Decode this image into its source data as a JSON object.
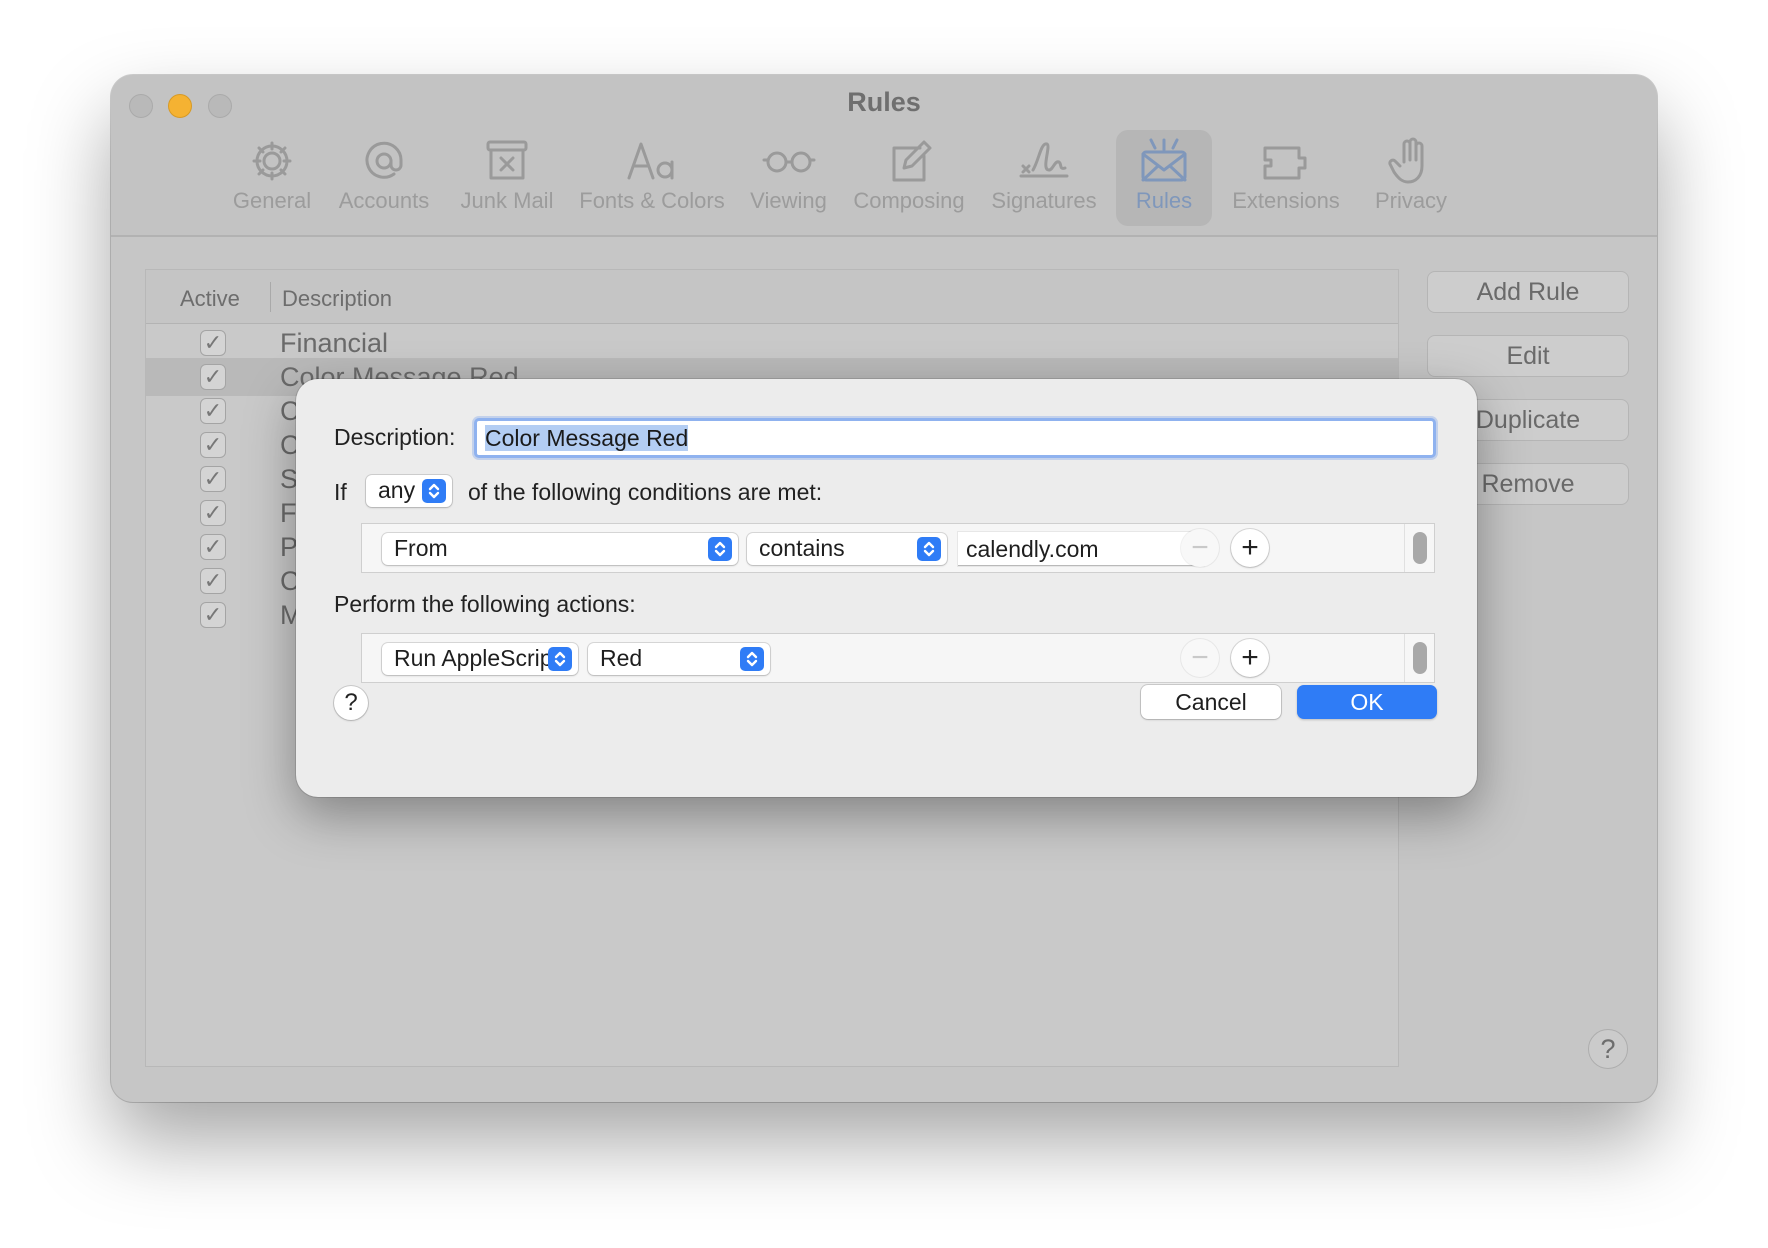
{
  "window": {
    "title": "Rules"
  },
  "toolbar": {
    "items": [
      {
        "label": "General",
        "icon": "gear-icon"
      },
      {
        "label": "Accounts",
        "icon": "at-sign-icon"
      },
      {
        "label": "Junk Mail",
        "icon": "junk-mail-icon"
      },
      {
        "label": "Fonts & Colors",
        "icon": "fonts-icon"
      },
      {
        "label": "Viewing",
        "icon": "glasses-icon"
      },
      {
        "label": "Composing",
        "icon": "compose-icon"
      },
      {
        "label": "Signatures",
        "icon": "signature-icon"
      },
      {
        "label": "Rules",
        "icon": "rules-envelope-icon",
        "selected": true
      },
      {
        "label": "Extensions",
        "icon": "extensions-icon"
      },
      {
        "label": "Privacy",
        "icon": "hand-icon"
      }
    ]
  },
  "rules_table": {
    "columns": {
      "active": "Active",
      "description": "Description"
    },
    "rows": [
      {
        "name": "Financial",
        "active": true
      },
      {
        "name": "Color Message Red",
        "active": true,
        "selected": true
      },
      {
        "name": "C",
        "active": true
      },
      {
        "name": "C",
        "active": true
      },
      {
        "name": "S",
        "active": true
      },
      {
        "name": "F",
        "active": true
      },
      {
        "name": "P",
        "active": true
      },
      {
        "name": "C",
        "active": true
      },
      {
        "name": "M",
        "active": true
      }
    ]
  },
  "side_buttons": {
    "add": "Add Rule",
    "edit": "Edit",
    "duplicate": "Duplicate",
    "remove": "Remove"
  },
  "window_help": "?",
  "sheet": {
    "description_label": "Description:",
    "description_value": "Color Message Red",
    "if_label": "If",
    "match_value": "any",
    "conditions_label": "of the following conditions are met:",
    "condition": {
      "field": "From",
      "operator": "contains",
      "value": "calendly.com"
    },
    "actions_label": "Perform the following actions:",
    "action": {
      "type": "Run AppleScript",
      "script": "Red"
    },
    "help": "?",
    "cancel": "Cancel",
    "ok": "OK"
  },
  "colors": {
    "accent": "#2f7cf6",
    "selection": "#b3cdf3",
    "minimize_button": "#f5b232"
  }
}
